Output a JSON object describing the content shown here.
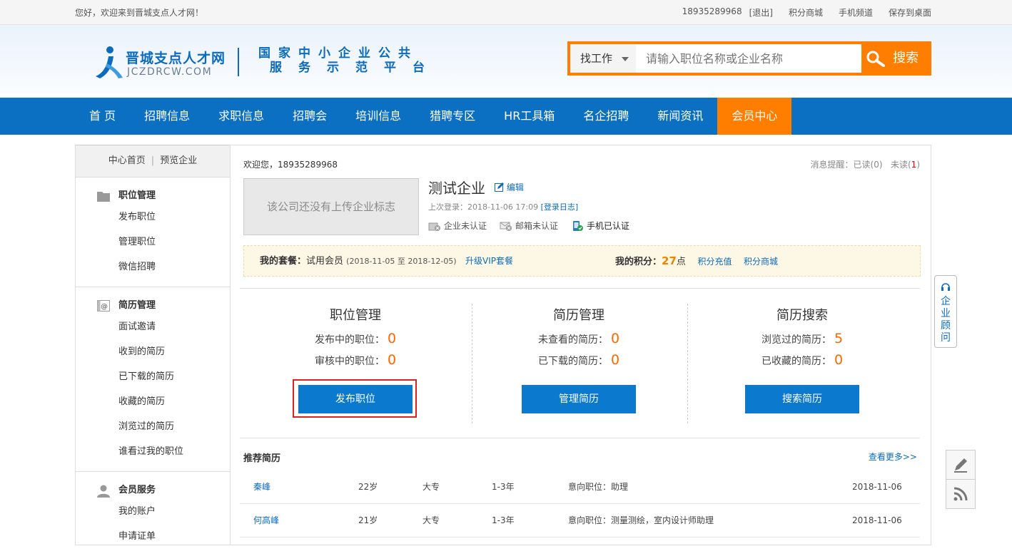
{
  "topbar": {
    "welcome": "您好，欢迎来到晋城支点人才网！",
    "phone": "18935289968",
    "logout": "[退出]",
    "links": [
      "积分商城",
      "手机频道",
      "保存到桌面"
    ]
  },
  "header": {
    "logo_cn": "晋城支点人才网",
    "logo_en": "JCZDRCW.COM",
    "slogan_line1": "国家中小企业公共",
    "slogan_line2": "服务示范平台",
    "search": {
      "type": "找工作",
      "placeholder": "请输入职位名称或企业名称",
      "button": "搜索"
    }
  },
  "nav": {
    "items": [
      "首 页",
      "招聘信息",
      "求职信息",
      "招聘会",
      "培训信息",
      "猎聘专区",
      "HR工具箱",
      "名企招聘",
      "新闻资讯",
      "会员中心"
    ],
    "active_index": 9
  },
  "sidebar": {
    "top_left": "中心首页",
    "top_right": "预览企业",
    "groups": [
      {
        "title": "职位管理",
        "icon": "folder-icon",
        "items": [
          "发布职位",
          "管理职位",
          "微信招聘"
        ]
      },
      {
        "title": "简历管理",
        "icon": "at-icon",
        "items": [
          "面试邀请",
          "收到的简历",
          "已下载的简历",
          "收藏的简历",
          "浏览过的简历",
          "谁看过我的职位"
        ]
      },
      {
        "title": "会员服务",
        "icon": "user-icon",
        "items": [
          "我的账户",
          "申请证单"
        ]
      }
    ]
  },
  "main": {
    "greeting": "欢迎您，18935289968",
    "messages": {
      "label": "消息提醒：",
      "read": "已读(0)",
      "unread_label": "未读(",
      "unread_count": "1",
      "unread_close": ")"
    },
    "logo_placeholder": "该公司还没有上传企业标志",
    "company_name": "测试企业",
    "edit_label": "编辑",
    "last_login_label": "上次登录：2018-11-06 17:09",
    "login_log": "[登录日志]",
    "certs": [
      {
        "label": "企业未认证",
        "ok": false
      },
      {
        "label": "邮箱未认证",
        "ok": false
      },
      {
        "label": "手机已认证",
        "ok": true
      }
    ],
    "package": {
      "label": "我的套餐：",
      "value": "试用会员",
      "period": "(2018-11-05 至 2018-12-05)",
      "upgrade": "升级VIP套餐",
      "points_label": "我的积分：",
      "points": "27",
      "points_unit": "点",
      "recharge": "积分充值",
      "shop": "积分商城"
    },
    "stats": [
      {
        "title": "职位管理",
        "rows": [
          {
            "label": "发布中的职位：",
            "value": "0"
          },
          {
            "label": "审核中的职位：",
            "value": "0"
          }
        ],
        "button": "发布职位"
      },
      {
        "title": "简历管理",
        "rows": [
          {
            "label": "未查看的简历：",
            "value": "0"
          },
          {
            "label": "已下载的简历：",
            "value": "0"
          }
        ],
        "button": "管理简历"
      },
      {
        "title": "简历搜索",
        "rows": [
          {
            "label": "浏览过的简历：",
            "value": "5"
          },
          {
            "label": "已收藏的简历：",
            "value": "0"
          }
        ],
        "button": "搜索简历"
      }
    ],
    "recommend": {
      "title": "推荐简历",
      "more": "查看更多>>",
      "rows": [
        {
          "name": "秦峰",
          "age": "22岁",
          "edu": "大专",
          "exp": "1-3年",
          "intent": "意向职位：助理",
          "date": "2018-11-06"
        },
        {
          "name": "何高峰",
          "age": "21岁",
          "edu": "大专",
          "exp": "1-3年",
          "intent": "意向职位：测量测绘，室内设计师助理",
          "date": "2018-11-06"
        }
      ]
    }
  },
  "advisor": {
    "label": "企业顾问"
  },
  "colors": {
    "brand_blue": "#0b70c2",
    "accent_orange": "#ff7e00",
    "highlight_red": "#e02020"
  }
}
